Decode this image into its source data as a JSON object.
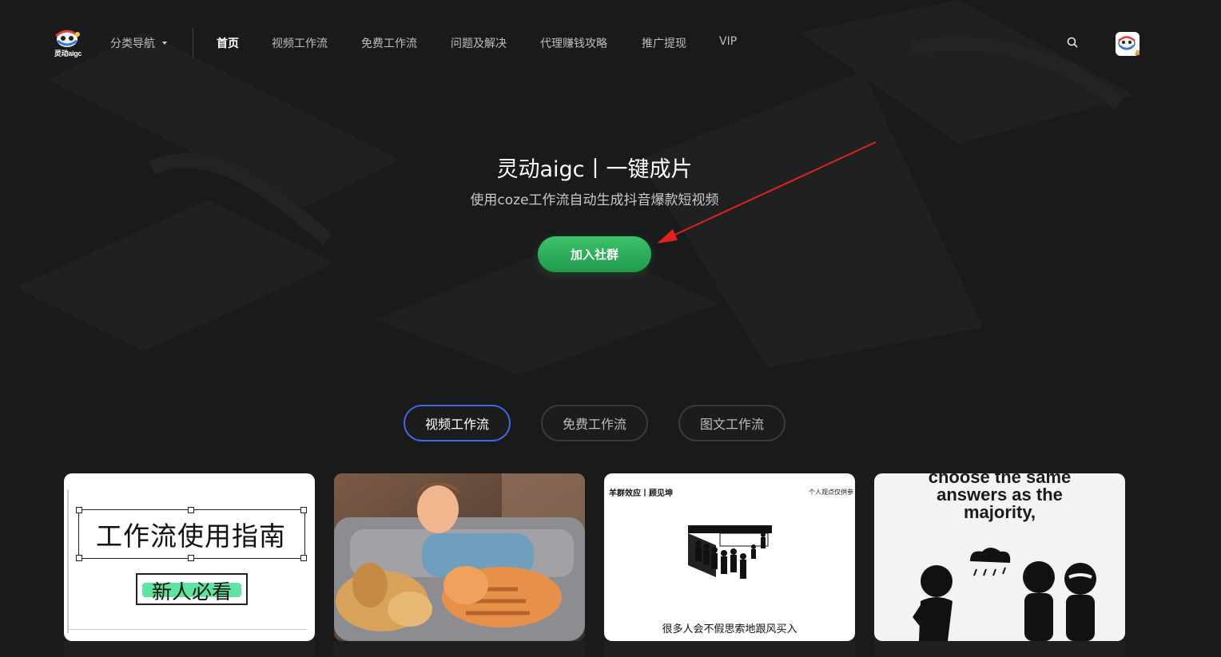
{
  "header": {
    "logo_text": "灵动aigc",
    "category_nav": "分类导航",
    "nav": [
      {
        "label": "首页",
        "active": true
      },
      {
        "label": "视频工作流"
      },
      {
        "label": "免费工作流"
      },
      {
        "label": "问题及解决"
      },
      {
        "label": "代理赚钱攻略"
      },
      {
        "label": "推广提现"
      },
      {
        "label": "VIP"
      }
    ],
    "search_icon": "search-icon"
  },
  "hero": {
    "title": "灵动aigc丨一键成片",
    "subtitle": "使用coze工作流自动生成抖音爆款短视频",
    "cta": "加入社群"
  },
  "tabs": [
    {
      "label": "视频工作流",
      "active": true
    },
    {
      "label": "免费工作流"
    },
    {
      "label": "图文工作流"
    }
  ],
  "cards": [
    {
      "title": "工作流使用指南",
      "badge": "新人必看"
    },
    {
      "image": "illustration-man-sleeping-with-dog-and-cat"
    },
    {
      "header_left": "羊群效应丨顾见坤",
      "header_right": "个人观点仅供参",
      "caption": "很多人会不假思索地跟风买入"
    },
    {
      "text_lines": [
        "choose the same",
        "answers as the",
        "majority,"
      ]
    }
  ],
  "colors": {
    "background": "#1a1a1b",
    "accent_green": "#2fb35c",
    "tab_active_border": "#3f67e8",
    "annotation_arrow": "#e0231f"
  }
}
